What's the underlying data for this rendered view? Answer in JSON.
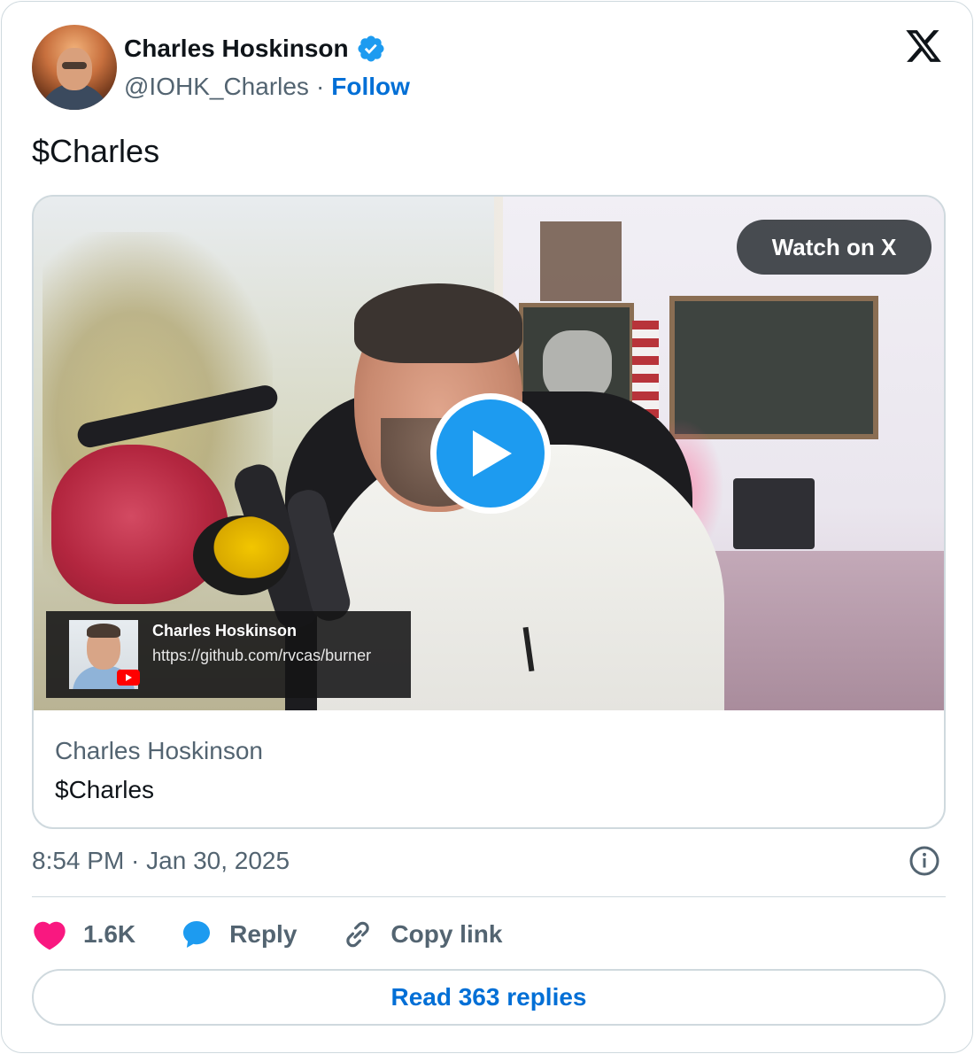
{
  "author": {
    "name": "Charles Hoskinson",
    "handle": "@IOHK_Charles",
    "separator": "·",
    "follow_label": "Follow",
    "verified_icon": "verified-badge-icon"
  },
  "brand_icon": "x-logo-icon",
  "tweet": {
    "text": "$Charles"
  },
  "media": {
    "watch_label": "Watch on X",
    "play_icon": "play-icon",
    "yt_overlay": {
      "title": "Charles Hoskinson",
      "url": "https://github.com/rvcas/burner",
      "badge_icon": "youtube-icon"
    },
    "link_author": "Charles Hoskinson",
    "link_text": "$Charles"
  },
  "meta": {
    "timestamp": "8:54 PM · Jan 30, 2025",
    "info_icon": "info-icon"
  },
  "actions": {
    "like_count": "1.6K",
    "reply_label": "Reply",
    "copy_label": "Copy link"
  },
  "read_replies_label": "Read 363 replies",
  "colors": {
    "accent_blue": "#006fd6",
    "play_blue": "#1d9bf0",
    "like_pink": "#f91880",
    "reply_blue": "#1d9bf0",
    "muted": "#536471",
    "border": "#cfd9de"
  }
}
